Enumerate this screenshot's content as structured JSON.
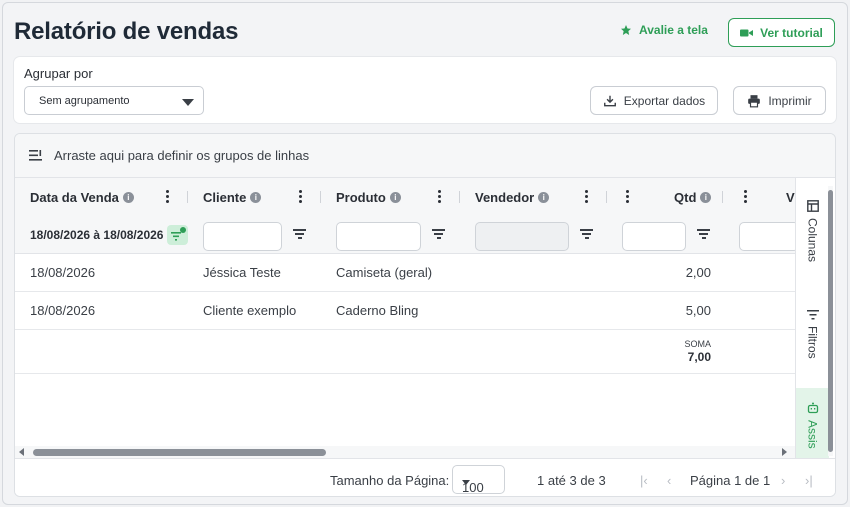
{
  "header": {
    "title": "Relatório de vendas",
    "rate_label": "Avalie a tela",
    "tutorial_label": "Ver tutorial"
  },
  "toolbar": {
    "group_label": "Agrupar por",
    "group_value": "Sem agrupamento",
    "export_label": "Exportar dados",
    "print_label": "Imprimir"
  },
  "grid": {
    "drag_hint": "Arraste aqui para definir os grupos de linhas",
    "columns": [
      "Data da Venda",
      "Cliente",
      "Produto",
      "Vendedor",
      "Qtd",
      "V"
    ],
    "date_filter": "18/08/2026 à 18/08/2026",
    "rows": [
      {
        "date": "18/08/2026",
        "client": "Jéssica Teste",
        "product": "Camiseta (geral)",
        "seller": "",
        "qty": "2,00"
      },
      {
        "date": "18/08/2026",
        "client": "Cliente exemplo",
        "product": "Caderno Bling",
        "seller": "",
        "qty": "5,00"
      }
    ],
    "sum_label": "SOMA",
    "sum_value": "7,00",
    "side_tabs": [
      "Colunas",
      "Filtros",
      "Assis"
    ]
  },
  "footer": {
    "page_size_label": "Tamanho da Página:",
    "page_size": "100",
    "range": "1 até 3 de 3",
    "page_label": "Página 1 de 1"
  },
  "colors": {
    "accent": "#2e9e57",
    "border": "#dde0e4"
  }
}
